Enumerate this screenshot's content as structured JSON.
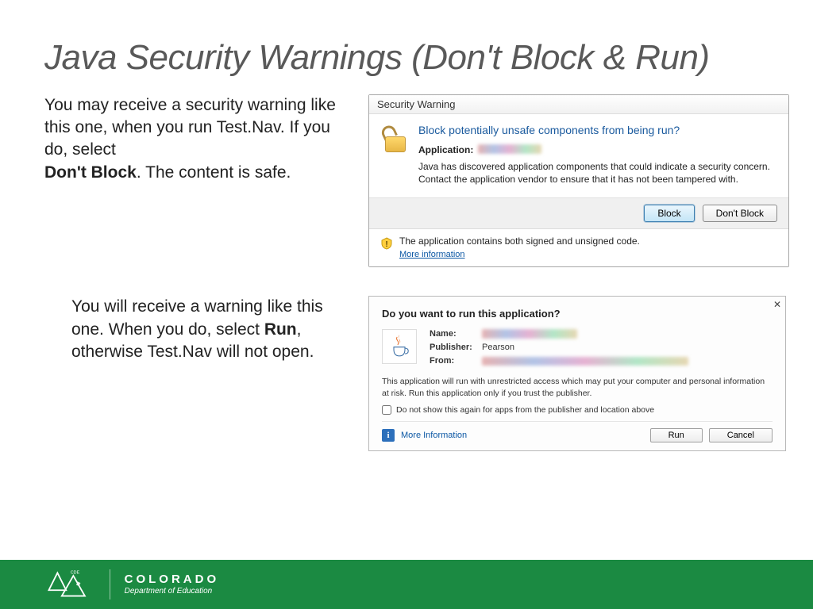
{
  "title": "Java Security Warnings (Don't Block & Run)",
  "paragraphs": {
    "p1_before_bold": "You may receive a security warning like this one, when you run Test.Nav. If you do, select ",
    "p1_bold": "Don't Block",
    "p1_after_bold": ". The content is safe.",
    "p2_before_bold": "You will receive a warning like this one. When you do, select ",
    "p2_bold": "Run",
    "p2_after_bold": ", otherwise Test.Nav will not open."
  },
  "dialog1": {
    "titlebar": "Security Warning",
    "question": "Block potentially unsafe components from being run?",
    "application_label": "Application:",
    "description": "Java has discovered application components that could indicate a security concern. Contact the application vendor to ensure that it has not been tampered with.",
    "btn_block": "Block",
    "btn_dont_block": "Don't Block",
    "signed_text": "The application contains both signed and unsigned code.",
    "more_info": "More information"
  },
  "dialog2": {
    "question": "Do you want to run this application?",
    "name_label": "Name:",
    "publisher_label": "Publisher:",
    "publisher_value": "Pearson",
    "from_label": "From:",
    "description": "This application will run with unrestricted access which may put your computer and personal information at risk. Run this application only if you trust the publisher.",
    "checkbox_label": "Do not show this again for apps from the publisher and location above",
    "more_info": "More Information",
    "btn_run": "Run",
    "btn_cancel": "Cancel"
  },
  "footer": {
    "brand_letters": "COLORADO",
    "department": "Department of Education",
    "badge_label": "CDE"
  },
  "icons": {
    "padlock": "unlock-icon",
    "warning_shield": "warning-shield-icon",
    "java_cup": "java-cup-icon",
    "info": "info-icon"
  }
}
